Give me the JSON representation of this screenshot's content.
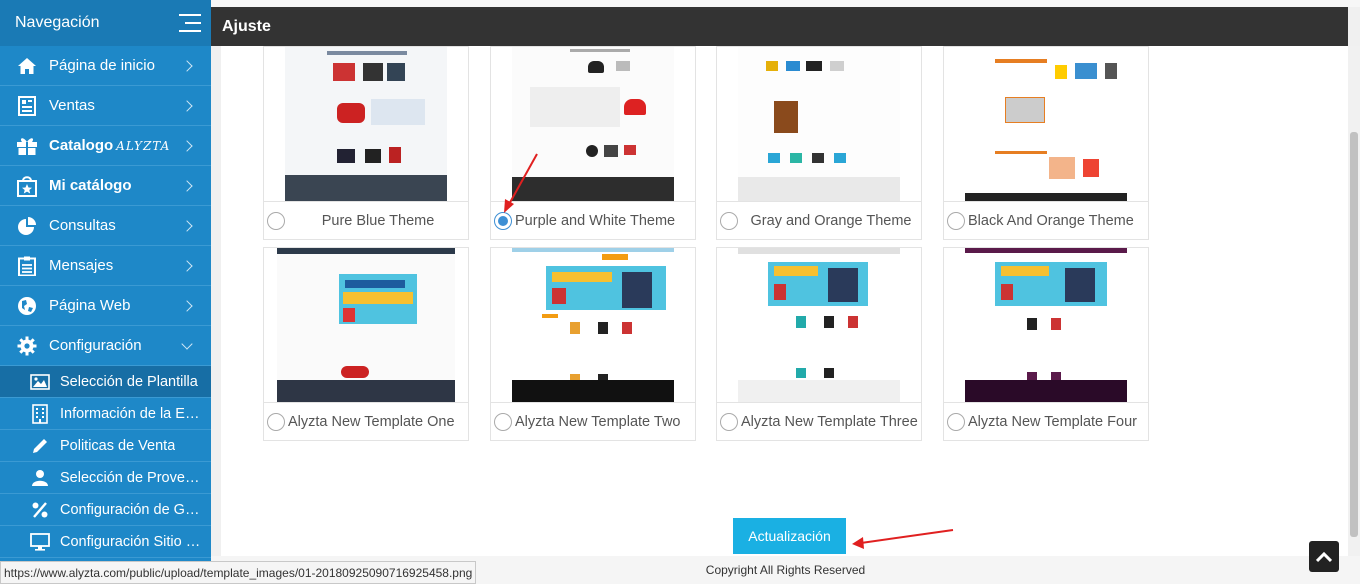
{
  "sidebar": {
    "title": "Navegación",
    "items": [
      {
        "label": "Página de inicio",
        "icon": "home-icon"
      },
      {
        "label": "Ventas",
        "icon": "receipt-icon"
      },
      {
        "label": "Catalogo",
        "suffix": "ALYZTA",
        "icon": "gift-icon"
      },
      {
        "label": "Mi catálogo",
        "icon": "star-bag-icon"
      },
      {
        "label": "Consultas",
        "icon": "pie-chart-icon"
      },
      {
        "label": "Mensajes",
        "icon": "clipboard-icon"
      },
      {
        "label": "Página Web",
        "icon": "globe-icon"
      },
      {
        "label": "Configuración",
        "icon": "gear-icon"
      }
    ],
    "subitems": [
      {
        "label": "Selección de Plantilla",
        "icon": "image-icon"
      },
      {
        "label": "Información de la Empresa",
        "icon": "building-icon"
      },
      {
        "label": "Politicas de Venta",
        "icon": "pencil-icon"
      },
      {
        "label": "Selección de Proveedores",
        "icon": "user-icon"
      },
      {
        "label": "Configuración de Ganancias",
        "icon": "percent-icon"
      },
      {
        "label": "Configuración Sitio Web",
        "icon": "monitor-icon"
      }
    ]
  },
  "header": {
    "title": "Ajuste"
  },
  "templates": [
    {
      "name": "Pure Blue Theme",
      "checked": false
    },
    {
      "name": "Purple and White Theme",
      "checked": true
    },
    {
      "name": "Gray and Orange Theme",
      "checked": false
    },
    {
      "name": "Black And Orange Theme",
      "checked": false
    },
    {
      "name": "Alyzta New Template One",
      "checked": false
    },
    {
      "name": "Alyzta New Template Two",
      "checked": false
    },
    {
      "name": "Alyzta New Template Three",
      "checked": false
    },
    {
      "name": "Alyzta New Template Four",
      "checked": false
    }
  ],
  "update_button": "Actualización",
  "footer": {
    "copyright": "Copyright All Rights Reserved"
  },
  "status_url": "https://www.alyzta.com/public/upload/template_images/01-20180925090716925458.png",
  "colors": {
    "sidebar": "#1e88c8",
    "topbar": "#333333",
    "button": "#1ab0e3",
    "annotation": "#e02020"
  }
}
